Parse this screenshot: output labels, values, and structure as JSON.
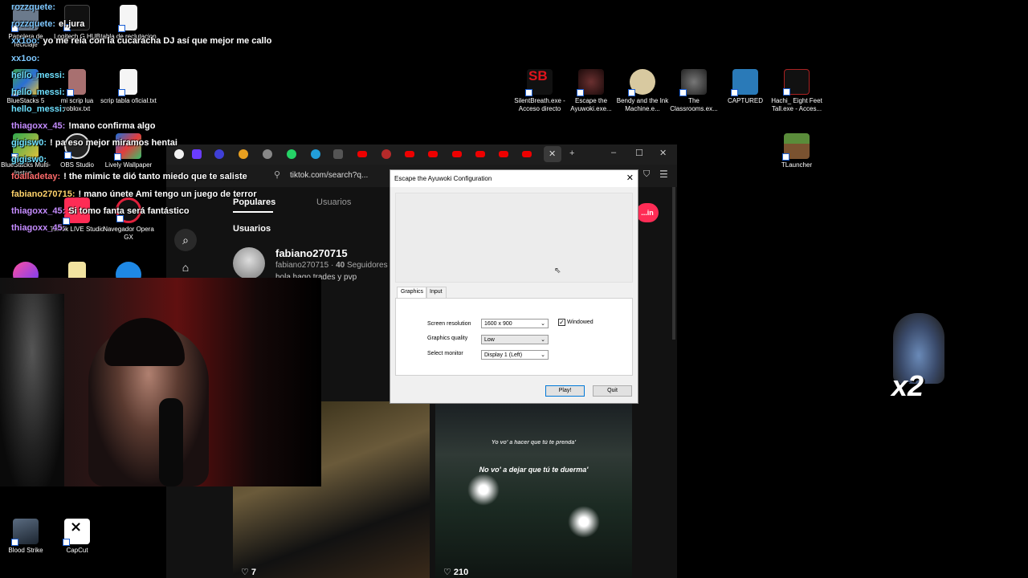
{
  "desktop_icons": [
    {
      "label": "Papelera de reciclaje",
      "color": "#6b7a8c"
    },
    {
      "label": "Logitech G HUB",
      "color": "#111111"
    },
    {
      "label": "tabla de reclutacion",
      "color": "#f5f5f5"
    },
    {
      "label": "BlueStacks 5",
      "color": "#3fa34d"
    },
    {
      "label": "mi scrip lua roblox.txt",
      "color": "#a87070"
    },
    {
      "label": "scrip tabla oficial.txt",
      "color": "#f5f5f5"
    },
    {
      "label": "BlueStacks Multi-Instan...",
      "color": "#2fa84f"
    },
    {
      "label": "OBS Studio",
      "color": "#222222"
    },
    {
      "label": "Lively Wallpaper",
      "color": "#1e6fd9"
    },
    {
      "label": "TikTok LIVE Studio",
      "color": "#fe2c55"
    },
    {
      "label": "Navegador Opera GX",
      "color": "#e0213c"
    },
    {
      "label": "Blood Strike",
      "color": "#445566"
    },
    {
      "label": "CapCut",
      "color": "#222222"
    },
    {
      "label": "SilentBreath.exe - Acceso directo",
      "color": "#c4141c"
    },
    {
      "label": "Escape the Ayuwoki.exe...",
      "color": "#3a1a1a"
    },
    {
      "label": "Bendy and the Ink Machine.e...",
      "color": "#d8c9a0"
    },
    {
      "label": "The Classrooms.ex...",
      "color": "#333333"
    },
    {
      "label": "CAPTURED",
      "color": "#2a7ab8"
    },
    {
      "label": "Hachi_ Eight Feet Tall.exe - Acces...",
      "color": "#111111"
    },
    {
      "label": "TLauncher",
      "color": "#5a8c3a"
    }
  ],
  "chat": [
    {
      "user": "rozzquete:",
      "msg": "",
      "color": "#7ec8ff"
    },
    {
      "user": "rozzquete:",
      "msg": "el jura",
      "color": "#7ec8ff"
    },
    {
      "user": "xx1oo:",
      "msg": "yo me reía con la cucaracha DJ así que mejor me callo",
      "color": "#7ec8ff"
    },
    {
      "user": "xx1oo:",
      "msg": "",
      "color": "#7ec8ff"
    },
    {
      "user": "hello_messi:",
      "msg": "",
      "color": "#6ee0ff"
    },
    {
      "user": "hello_messi:",
      "msg": "",
      "color": "#6ee0ff"
    },
    {
      "user": "hello_messi:",
      "msg": "",
      "color": "#6ee0ff"
    },
    {
      "user": "thiagoxx_45:",
      "msg": "!mano confirma algo",
      "color": "#c58cff"
    },
    {
      "user": "gigisw0:",
      "msg": "! pa eso mejor miramos hentai",
      "color": "#6ee0ff"
    },
    {
      "user": "gigisw0:",
      "msg": "",
      "color": "#6ee0ff"
    },
    {
      "user": "foalladetay:",
      "msg": "! the mimic te dió tanto miedo que te saliste",
      "color": "#ff6b6b"
    },
    {
      "user": "fabiano270715:",
      "msg": "! mano únete Ami tengo un juego de terror",
      "color": "#ffd36b"
    },
    {
      "user": "thiagoxx_45:",
      "msg": "Si tomo fanta será fantástico",
      "color": "#c58cff"
    },
    {
      "user": "thiagoxx_45:",
      "msg": "",
      "color": "#c58cff"
    }
  ],
  "browser": {
    "url": "tiktok.com/search?q...",
    "tabs": [
      "Populares",
      "Usuarios"
    ],
    "section_title": "Usuarios",
    "user_name": "fabiano270715",
    "user_handle": "fabiano270715",
    "user_followers": "40",
    "user_followers_label": "Seguidores",
    "user_desc": "hola hago trades y pvp",
    "login_label": "...in",
    "likes_a": "7",
    "likes_b": "210",
    "caption_1": "Yo vo' a hacer que tú te prenda'",
    "caption_2": "No vo' a dejar que tú te duerma'"
  },
  "dialog": {
    "title": "Escape the Ayuwoki Configuration",
    "tabs": [
      "Graphics",
      "Input"
    ],
    "fields": [
      {
        "label": "Screen resolution",
        "value": "1600 x 900"
      },
      {
        "label": "Graphics quality",
        "value": "Low"
      },
      {
        "label": "Select monitor",
        "value": "Display 1 (Left)"
      }
    ],
    "windowed_label": "Windowed",
    "windowed_checked": true,
    "play_label": "Play!",
    "quit_label": "Quit"
  },
  "sticker": {
    "text": "x2"
  }
}
